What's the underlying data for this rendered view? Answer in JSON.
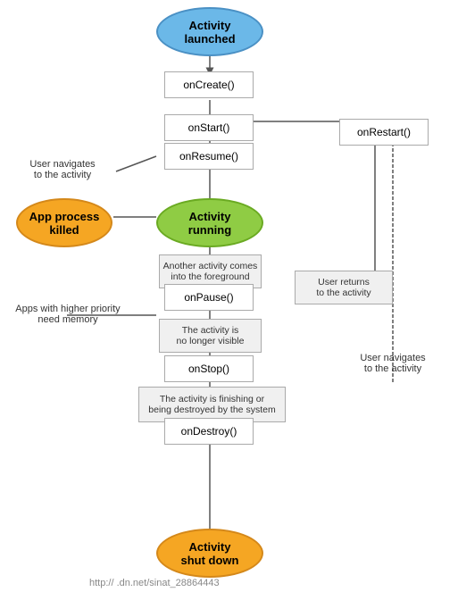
{
  "nodes": {
    "activity_launched": {
      "label": "Activity\nlaunched"
    },
    "on_create": {
      "label": "onCreate()"
    },
    "on_start": {
      "label": "onStart()"
    },
    "on_restart": {
      "label": "onRestart()"
    },
    "on_resume": {
      "label": "onResume()"
    },
    "activity_running": {
      "label": "Activity\nrunning"
    },
    "app_process_killed": {
      "label": "App process\nkilled"
    },
    "another_activity": {
      "label": "Another activity comes\ninto the foreground"
    },
    "on_pause": {
      "label": "onPause()"
    },
    "no_longer_visible": {
      "label": "The activity is\nno longer visible"
    },
    "on_stop": {
      "label": "onStop()"
    },
    "finishing_or_destroyed": {
      "label": "The activity is finishing or\nbeing destroyed by the system"
    },
    "on_destroy": {
      "label": "onDestroy()"
    },
    "activity_shut_down": {
      "label": "Activity\nshut down"
    },
    "user_navigates_to": {
      "label": "User navigates\nto the activity"
    },
    "apps_higher_priority": {
      "label": "Apps with higher priority\nneed memory"
    },
    "user_returns_to": {
      "label": "User returns\nto the activity"
    },
    "user_navigates_to2": {
      "label": "User navigates\nto the activity"
    }
  },
  "watermark": "http://      .dn.net/sinat_28864443"
}
